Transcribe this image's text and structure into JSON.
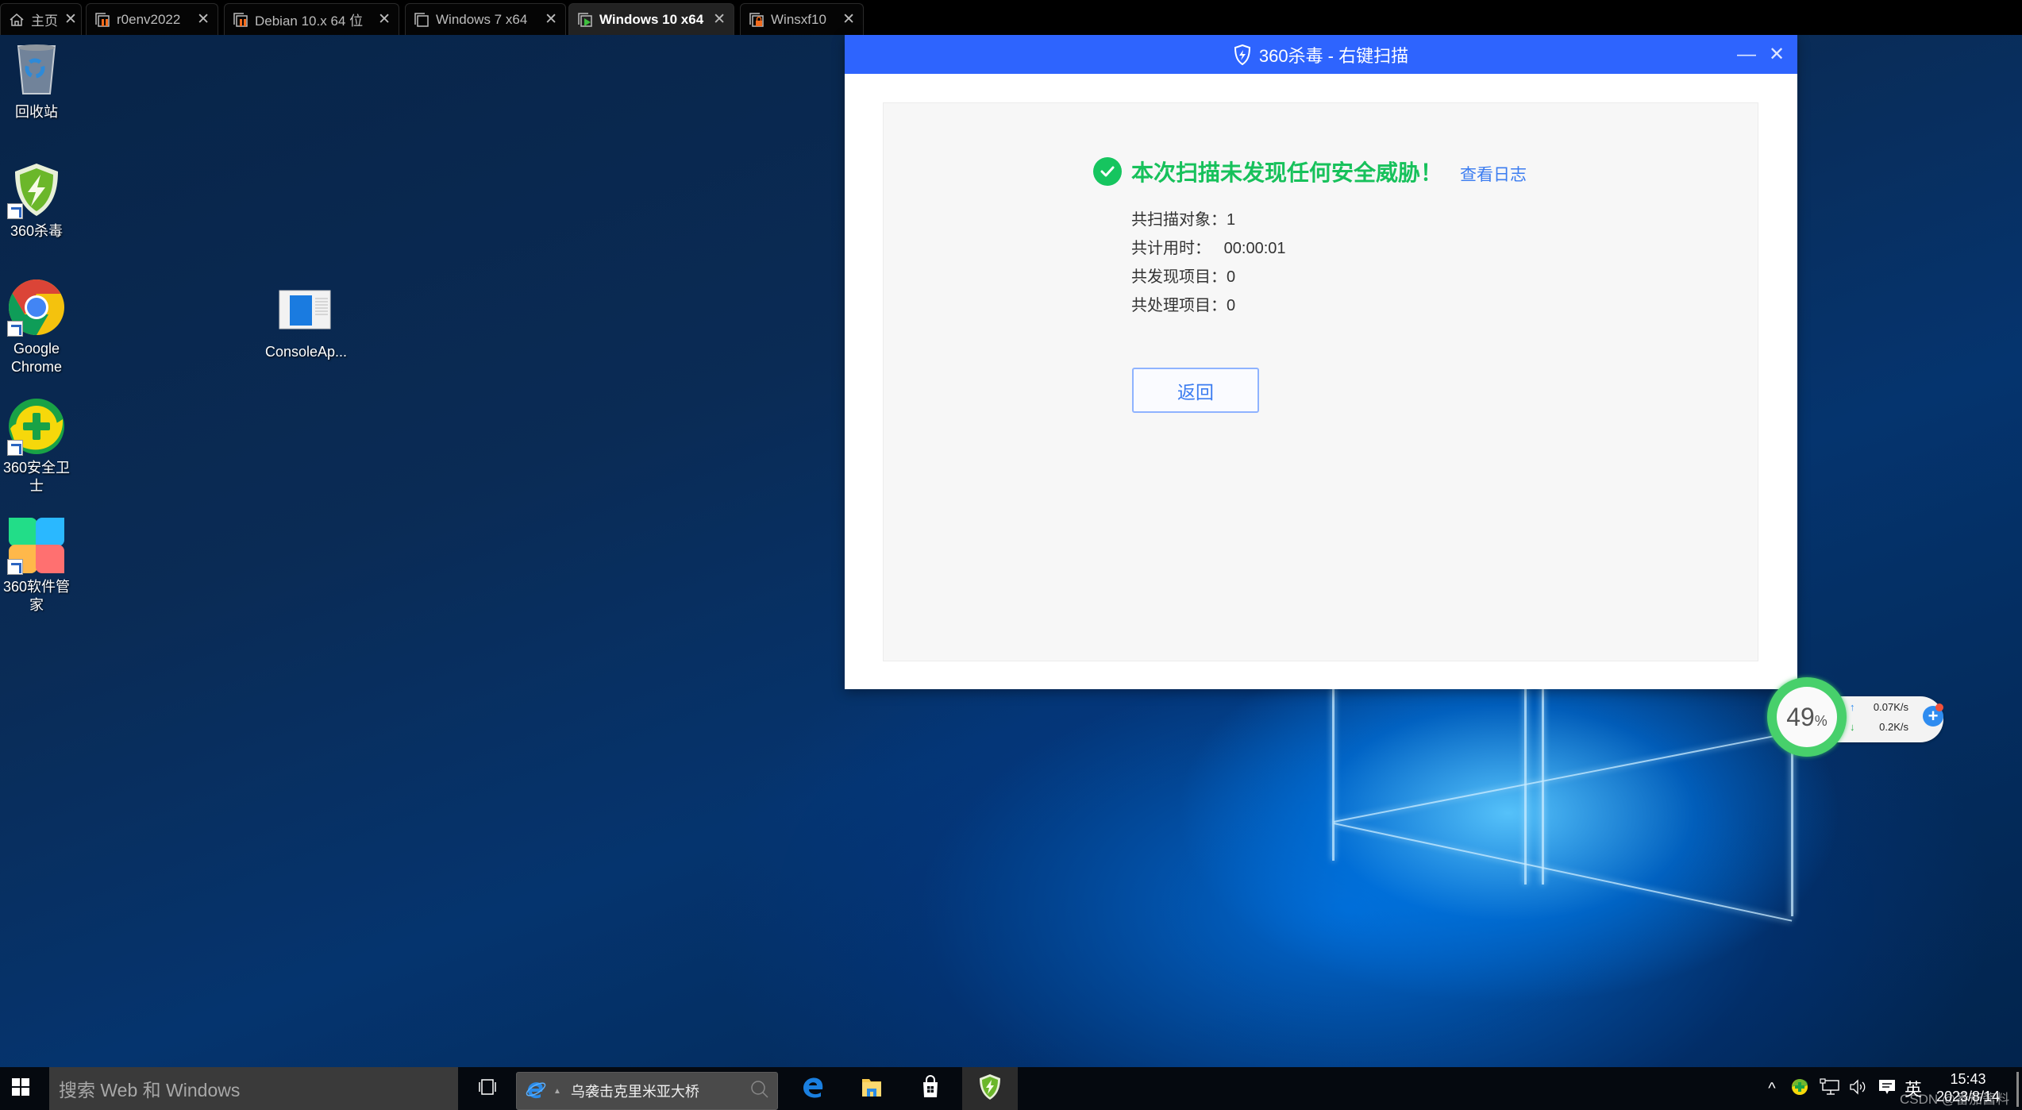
{
  "vm_tabs": [
    {
      "label": "主页",
      "icon": "home-icon",
      "active": false
    },
    {
      "label": "r0env2022",
      "icon": "vm-paused-icon",
      "active": false
    },
    {
      "label": "Debian 10.x 64 位",
      "icon": "vm-paused-icon",
      "active": false
    },
    {
      "label": "Windows 7 x64",
      "icon": "vm-off-icon",
      "active": false
    },
    {
      "label": "Windows 10 x64",
      "icon": "vm-running-icon",
      "active": true
    },
    {
      "label": "Winsxf10",
      "icon": "vm-locked-icon",
      "active": false
    }
  ],
  "tab_close_glyph": "✕",
  "desktop_icons": [
    {
      "label": "回收站",
      "icon": "recycle-bin-icon"
    },
    {
      "label": "360杀毒",
      "icon": "360-antivirus-icon"
    },
    {
      "label": "Google Chrome",
      "icon": "chrome-icon"
    },
    {
      "label": "360安全卫士",
      "icon": "360-security-icon"
    },
    {
      "label": "360软件管家",
      "icon": "360-software-manager-icon"
    },
    {
      "label": "ConsoleAp...",
      "icon": "console-app-icon"
    }
  ],
  "dialog": {
    "title": "360杀毒 - 右键扫描",
    "minimize_glyph": "—",
    "close_glyph": "✕",
    "result_title": "本次扫描未发现任何安全威胁！",
    "view_log_label": "查看日志",
    "stats": [
      {
        "label": "共扫描对象：",
        "value": "1"
      },
      {
        "label": "共计用时：   ",
        "value": "00:00:01"
      },
      {
        "label": "共发现项目：",
        "value": "0"
      },
      {
        "label": "共处理项目：",
        "value": "0"
      }
    ],
    "back_label": "返回",
    "accent_color": "#2e64fe",
    "success_color": "#17c15b"
  },
  "speed_widget": {
    "percent_value": "49",
    "percent_sign": "%",
    "upload": "0.07K/s",
    "download": "0.2K/s",
    "upload_arrow": "↑",
    "download_arrow": "↓",
    "plus_glyph": "+"
  },
  "taskbar": {
    "search_placeholder": "搜索 Web 和 Windows",
    "ie_news_text": "乌袭击克里米亚大桥",
    "pinned_apps": [
      {
        "name": "edge",
        "active": false
      },
      {
        "name": "file-explorer",
        "active": false
      },
      {
        "name": "store",
        "active": false
      },
      {
        "name": "360-antivirus",
        "active": true
      }
    ],
    "tray": {
      "show_hidden_glyph": "^",
      "ime_label": "英"
    },
    "clock": {
      "time": "15:43",
      "date": "2023/8/14"
    },
    "watermark": "CSDN @番茄酱料"
  }
}
